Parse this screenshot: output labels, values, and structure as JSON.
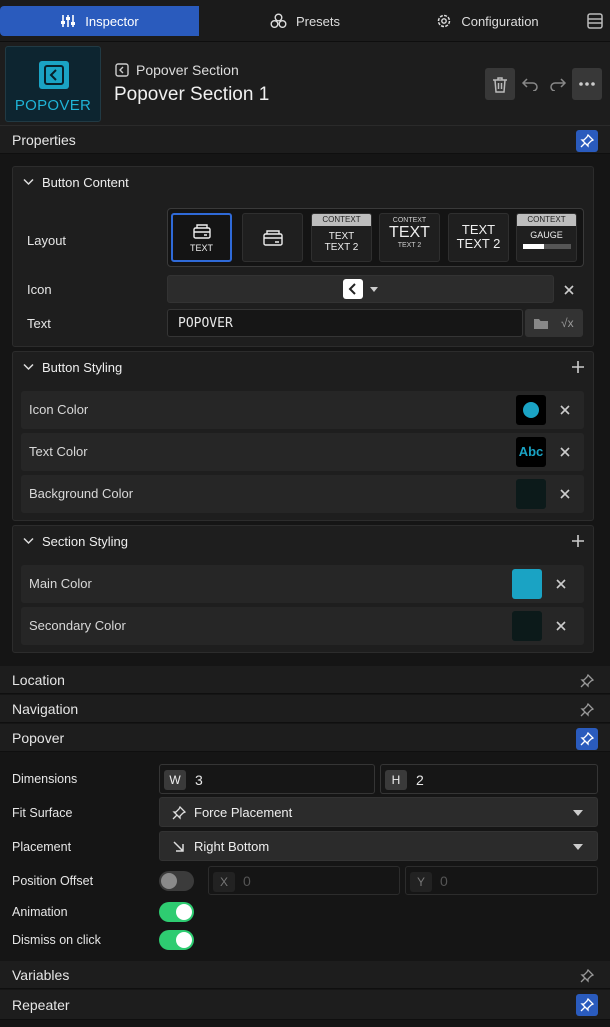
{
  "tabs": [
    {
      "label": "Inspector",
      "icon": "sliders-icon"
    },
    {
      "label": "Presets",
      "icon": "circles-icon"
    },
    {
      "label": "Configuration",
      "icon": "gear-icon"
    }
  ],
  "header": {
    "thumbnail_label": "POPOVER",
    "kind": "Popover Section",
    "title": "Popover Section 1"
  },
  "sections": {
    "properties": "Properties",
    "location": "Location",
    "navigation": "Navigation",
    "popover": "Popover",
    "variables": "Variables",
    "repeater": "Repeater"
  },
  "button_content": {
    "title": "Button Content",
    "layout_label": "Layout",
    "layout_options": [
      {
        "text": "TEXT"
      },
      {
        "text": ""
      },
      {
        "context": "CONTEXT",
        "line1": "TEXT",
        "line2": "TEXT 2"
      },
      {
        "context": "CONTEXT",
        "line1": "TEXT",
        "line2": "TEXT 2"
      },
      {
        "line1": "TEXT",
        "line2": "TEXT 2"
      },
      {
        "context": "CONTEXT",
        "line1": "GAUGE"
      }
    ],
    "icon_label": "Icon",
    "text_label": "Text",
    "text_value": "POPOVER"
  },
  "button_styling": {
    "title": "Button Styling",
    "rows": [
      {
        "label": "Icon Color"
      },
      {
        "label": "Text Color",
        "swatch_text": "Abc"
      },
      {
        "label": "Background Color"
      }
    ]
  },
  "section_styling": {
    "title": "Section Styling",
    "rows": [
      {
        "label": "Main Color"
      },
      {
        "label": "Secondary Color"
      }
    ]
  },
  "popover": {
    "dimensions_label": "Dimensions",
    "w_tag": "W",
    "w_value": "3",
    "h_tag": "H",
    "h_value": "2",
    "fit_surface_label": "Fit Surface",
    "fit_surface_value": "Force Placement",
    "placement_label": "Placement",
    "placement_value": "Right Bottom",
    "position_offset_label": "Position Offset",
    "x_tag": "X",
    "x_placeholder": "0",
    "y_tag": "Y",
    "y_placeholder": "0",
    "animation_label": "Animation",
    "dismiss_label": "Dismiss on click",
    "position_offset_enabled": false,
    "animation_enabled": true,
    "dismiss_enabled": true
  },
  "colors": {
    "accent": "#2a5bbd",
    "cyan": "#1aa3c4",
    "toggle_on": "#2ecc71",
    "swatch_dark": "#0c1a1a"
  }
}
